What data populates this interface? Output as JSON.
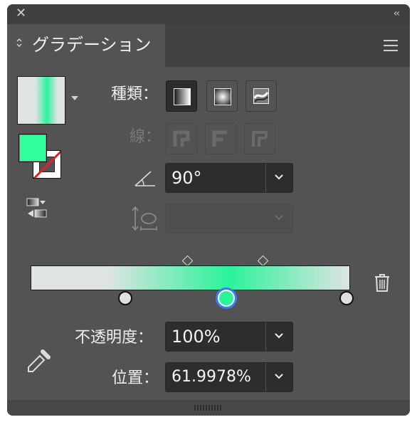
{
  "window": {
    "close_icon": "close-icon",
    "collapse_icon": "collapse-icon",
    "close_glyph": "✕",
    "collapse_glyph": "‹‹"
  },
  "panel": {
    "title": "グラデーション",
    "tab_arrows_glyph": "⌃\n⌄",
    "menu_icon": "hamburger-menu-icon"
  },
  "gradient": {
    "preview_icon": "gradient-preview-swatch",
    "fill_color": "#33ff9c",
    "stroke_state": "none",
    "reverse_icon": "reverse-gradient-icon",
    "stops": [
      {
        "color": "#dfe3e3",
        "location": 0
      },
      {
        "color": "#2bf39a",
        "location": 61.9978
      },
      {
        "color": "#dfe3e3",
        "location": 100
      }
    ],
    "midpoints": [
      24,
      74
    ]
  },
  "type": {
    "label": "種類：",
    "options": [
      "linear-gradient-icon",
      "radial-gradient-icon",
      "freeform-gradient-icon"
    ],
    "selected": 0
  },
  "stroke": {
    "label": "線：",
    "options": [
      "stroke-within-icon",
      "stroke-along-icon",
      "stroke-across-icon"
    ]
  },
  "angle": {
    "icon": "angle-icon",
    "value": "90°"
  },
  "aspect": {
    "icon": "aspect-ratio-icon",
    "value": ""
  },
  "opacity": {
    "label": "不透明度：",
    "value": "100%"
  },
  "location": {
    "label": "位置：",
    "value": "61.9978%"
  },
  "tools": {
    "trash_icon": "trash-icon",
    "eyedropper_icon": "eyedropper-icon"
  },
  "colors": {
    "panel_bg": "#535353",
    "accent_green": "#2bf39a",
    "selection_blue": "#3c7cf0"
  }
}
